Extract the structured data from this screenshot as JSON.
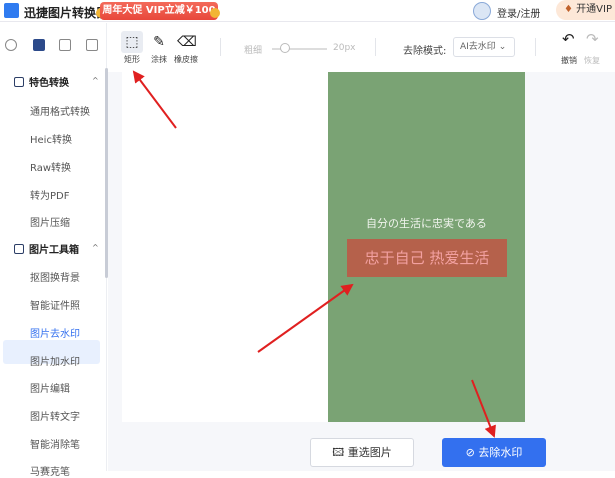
{
  "header": {
    "app_title": "迅捷图片转换器",
    "promo": "周年大促 VIP立减￥100",
    "login": "登录/注册",
    "vip": "开通VIP"
  },
  "sidebar": {
    "groups": [
      {
        "label": "特色转换",
        "items": [
          "通用格式转换",
          "Heic转换",
          "Raw转换",
          "转为PDF",
          "图片压缩"
        ]
      },
      {
        "label": "图片工具箱",
        "items": [
          "抠图换背景",
          "智能证件照",
          "图片去水印",
          "图片加水印",
          "图片编辑",
          "图片转文字",
          "智能消除笔",
          "马赛克笔"
        ]
      }
    ],
    "active": "图片去水印"
  },
  "toolbar": {
    "rect": "矩形",
    "smear": "涂抹",
    "eraser": "橡皮擦",
    "thickness": "粗细",
    "thickness_value": "20px",
    "mode_label": "去除模式:",
    "mode_value": "AI去水印",
    "undo": "撤销",
    "redo": "恢复"
  },
  "image": {
    "line1": "自分の生活に忠実である",
    "watermark": "忠于自己 热爱生活"
  },
  "bottom": {
    "reselect": "重选图片",
    "remove": "去除水印"
  },
  "colors": {
    "accent": "#3370ef",
    "photo": "#7aa374",
    "watermark_bg": "#b5614b",
    "arrow": "#e02020"
  }
}
